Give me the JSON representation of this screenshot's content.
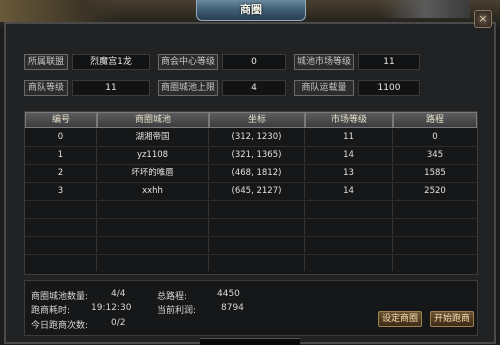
{
  "window": {
    "title": "商圈",
    "close_label": "×"
  },
  "info": {
    "alliance_label": "所属联盟",
    "alliance_value": "烈魔宫1龙",
    "center_level_label": "商会中心等级",
    "center_level_value": "0",
    "city_market_label": "城池市场等级",
    "city_market_value": "11",
    "team_level_label": "商队等级",
    "team_level_value": "11",
    "city_limit_label": "商圈城池上限",
    "city_limit_value": "4",
    "team_capacity_label": "商队运载量",
    "team_capacity_value": "1100"
  },
  "table": {
    "headers": [
      "编号",
      "商圈城池",
      "坐标",
      "市场等级",
      "路程"
    ],
    "rows": [
      [
        "0",
        "湖湘帝国",
        "(312, 1230)",
        "11",
        "0"
      ],
      [
        "1",
        "yz1108",
        "(321, 1365)",
        "14",
        "345"
      ],
      [
        "2",
        "坏坏的唯唇",
        "(468, 1812)",
        "13",
        "1585"
      ],
      [
        "3",
        "xxhh",
        "(645, 2127)",
        "14",
        "2520"
      ]
    ]
  },
  "footer": {
    "city_count_label": "商圈城池数量:",
    "city_count_value": "4/4",
    "total_distance_label": "总路程:",
    "total_distance_value": "4450",
    "run_time_label": "跑商耗时:",
    "run_time_value": "19:12:30",
    "profit_label": "当前利润:",
    "profit_value": "8794",
    "today_runs_label": "今日跑商次数:",
    "today_runs_value": "0/2",
    "set_circle_button": "设定商圈",
    "start_run_button": "开始跑商"
  }
}
